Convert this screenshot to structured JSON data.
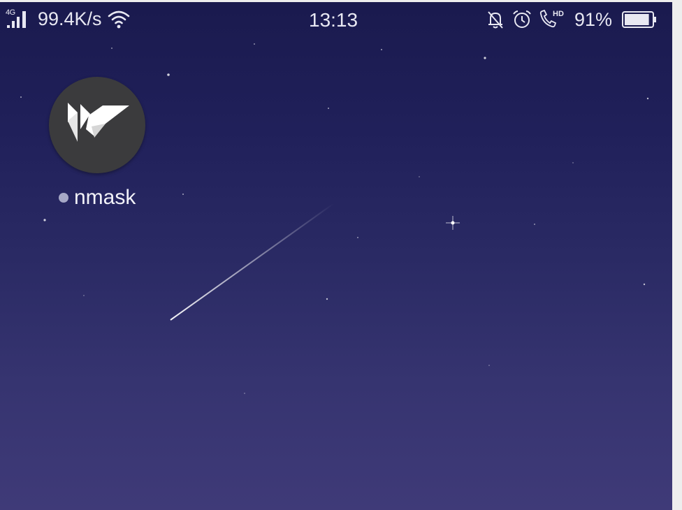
{
  "status_bar": {
    "network_type": "4G",
    "signal_icon": "cellular-signal-icon",
    "speed": "99.4K/s",
    "wifi_icon": "wifi-icon",
    "time": "13:13",
    "silent_icon": "bell-off-icon",
    "alarm_icon": "alarm-icon",
    "hd_call_icon": "hd-call-icon",
    "battery_percent": "91%",
    "battery_level": 0.91
  },
  "home": {
    "apps": [
      {
        "label": "nmask",
        "icon": "kivy-logo-icon",
        "new_install_dot": true
      }
    ]
  },
  "colors": {
    "wallpaper_top": "#1a1a4e",
    "wallpaper_bottom": "#3f3a78",
    "app_icon_bg": "#3b3b3d",
    "status_text": "#e8e8f2"
  }
}
